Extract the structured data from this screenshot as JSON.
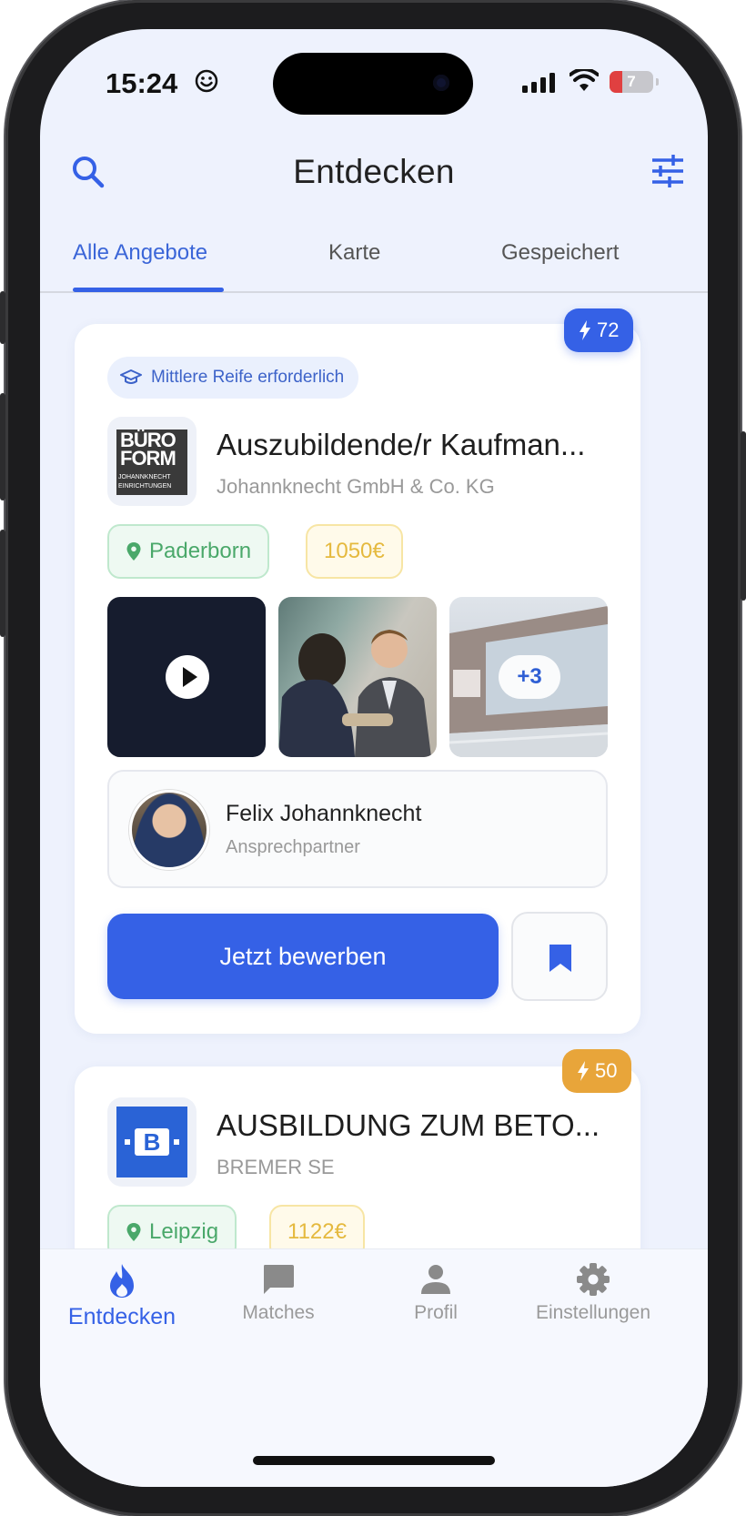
{
  "status_bar": {
    "time": "15:24",
    "battery": "7"
  },
  "header": {
    "title": "Entdecken"
  },
  "tabs": [
    {
      "label": "Alle Angebote",
      "active": true
    },
    {
      "label": "Karte",
      "active": false
    },
    {
      "label": "Gespeichert",
      "active": false
    }
  ],
  "jobs": [
    {
      "score": "72",
      "requirement": "Mittlere Reife erforderlich",
      "logo_text": "BÜRO FORM",
      "logo_subtext": "JOHANNKNECHT EINRICHTUNGEN",
      "title": "Auszubildende/r Kaufman...",
      "company": "Johannknecht GmbH & Co. KG",
      "location": "Paderborn",
      "salary": "1050€",
      "more_media": "+3",
      "contact_name": "Felix Johannknecht",
      "contact_role": "Ansprechpartner",
      "apply_label": "Jetzt bewerben"
    },
    {
      "score": "50",
      "logo_text": "B",
      "title": "AUSBILDUNG ZUM BETO...",
      "company": "BREMER SE",
      "location": "Leipzig",
      "salary": "1122€"
    }
  ],
  "bottom_nav": [
    {
      "label": "Entdecken",
      "icon": "flame-icon",
      "active": true
    },
    {
      "label": "Matches",
      "icon": "chat-icon",
      "active": false
    },
    {
      "label": "Profil",
      "icon": "person-icon",
      "active": false
    },
    {
      "label": "Einstellungen",
      "icon": "gear-icon",
      "active": false
    }
  ],
  "colors": {
    "accent": "#3561e6",
    "score_high": "#3561e6",
    "score_medium": "#e8a53a",
    "location_green": "#4aa86a",
    "salary_yellow": "#e5b93e"
  }
}
